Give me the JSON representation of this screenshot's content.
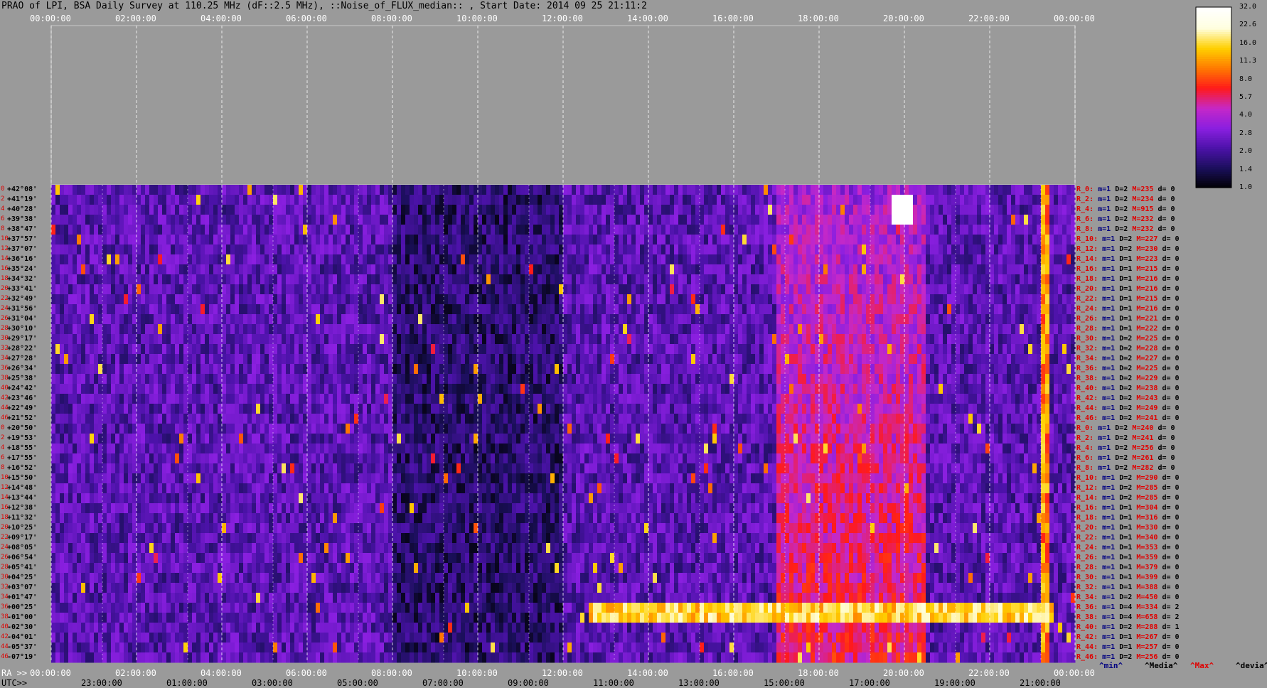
{
  "chart_data": {
    "type": "heatmap",
    "title": "PRAO of LPI, BSA Daily Survey at 110.25 MHz (dF::2.5 MHz), ::Noise_of_FLUX_median:: , Start Date: 2014 09 25 21:11:2",
    "x_top_ticks": [
      "00:00:00",
      "02:00:00",
      "04:00:00",
      "06:00:00",
      "08:00:00",
      "10:00:00",
      "12:00:00",
      "14:00:00",
      "16:00:00",
      "18:00:00",
      "20:00:00",
      "22:00:00",
      "00:00:00"
    ],
    "ra_label": "RA >>",
    "ra_ticks": [
      "00:00:00",
      "02:00:00",
      "04:00:00",
      "06:00:00",
      "08:00:00",
      "10:00:00",
      "12:00:00",
      "14:00:00",
      "16:00:00",
      "18:00:00",
      "20:00:00",
      "22:00:00",
      "00:00:00"
    ],
    "utc_label": "UTC>>",
    "utc_ticks": [
      "23:00:00",
      "01:00:00",
      "03:00:00",
      "05:00:00",
      "07:00:00",
      "09:00:00",
      "11:00:00",
      "13:00:00",
      "15:00:00",
      "17:00:00",
      "19:00:00",
      "21:00:00"
    ],
    "beam_index": [
      "0",
      "2",
      "4",
      "6",
      "8",
      "10",
      "12",
      "14",
      "16",
      "18",
      "20",
      "22",
      "24",
      "26",
      "28",
      "30",
      "32",
      "34",
      "36",
      "38",
      "40",
      "42",
      "44",
      "46",
      "0",
      "2",
      "4",
      "6",
      "8",
      "10",
      "12",
      "14",
      "16",
      "18",
      "20",
      "22",
      "24",
      "26",
      "28",
      "30",
      "32",
      "34",
      "36",
      "38",
      "40",
      "42",
      "44",
      "46"
    ],
    "declinations": [
      "+42°08'",
      "+41°19'",
      "+40°28'",
      "+39°38'",
      "+38°47'",
      "+37°57'",
      "+37°07'",
      "+36°16'",
      "+35°24'",
      "+34°32'",
      "+33°41'",
      "+32°49'",
      "+31°56'",
      "+31°04'",
      "+30°10'",
      "+29°17'",
      "+28°22'",
      "+27°28'",
      "+26°34'",
      "+25°38'",
      "+24°42'",
      "+23°46'",
      "+22°49'",
      "+21°52'",
      "+20°50'",
      "+19°53'",
      "+18°55'",
      "+17°55'",
      "+16°52'",
      "+15°50'",
      "+14°48'",
      "+13°44'",
      "+12°38'",
      "+11°32'",
      "+10°25'",
      "+09°17'",
      "+08°05'",
      "+06°54'",
      "+05°41'",
      "+04°25'",
      "+03°07'",
      "+01°47'",
      "+00°25'",
      "-01°00'",
      "-02°30'",
      "-04°01'",
      "-05°37'",
      "-07°19'"
    ],
    "row_stats": [
      {
        "r": "R_0:",
        "m": "m=1",
        "d": "D=2",
        "M": "M=235",
        "dv": "d= 0"
      },
      {
        "r": "R_2:",
        "m": "m=1",
        "d": "D=2",
        "M": "M=234",
        "dv": "d= 0"
      },
      {
        "r": "R_4:",
        "m": "m=1",
        "d": "D=2",
        "M": "M=915",
        "dv": "d= 0"
      },
      {
        "r": "R_6:",
        "m": "m=1",
        "d": "D=2",
        "M": "M=232",
        "dv": "d= 0"
      },
      {
        "r": "R_8:",
        "m": "m=1",
        "d": "D=2",
        "M": "M=232",
        "dv": "d= 0"
      },
      {
        "r": "R_10:",
        "m": "m=1",
        "d": "D=2",
        "M": "M=227",
        "dv": "d= 0"
      },
      {
        "r": "R_12:",
        "m": "m=1",
        "d": "D=2",
        "M": "M=230",
        "dv": "d= 0"
      },
      {
        "r": "R_14:",
        "m": "m=1",
        "d": "D=1",
        "M": "M=223",
        "dv": "d= 0"
      },
      {
        "r": "R_16:",
        "m": "m=1",
        "d": "D=1",
        "M": "M=215",
        "dv": "d= 0"
      },
      {
        "r": "R_18:",
        "m": "m=1",
        "d": "D=1",
        "M": "M=216",
        "dv": "d= 0"
      },
      {
        "r": "R_20:",
        "m": "m=1",
        "d": "D=1",
        "M": "M=216",
        "dv": "d= 0"
      },
      {
        "r": "R_22:",
        "m": "m=1",
        "d": "D=1",
        "M": "M=215",
        "dv": "d= 0"
      },
      {
        "r": "R_24:",
        "m": "m=1",
        "d": "D=1",
        "M": "M=216",
        "dv": "d= 0"
      },
      {
        "r": "R_26:",
        "m": "m=1",
        "d": "D=1",
        "M": "M=221",
        "dv": "d= 0"
      },
      {
        "r": "R_28:",
        "m": "m=1",
        "d": "D=1",
        "M": "M=222",
        "dv": "d= 0"
      },
      {
        "r": "R_30:",
        "m": "m=1",
        "d": "D=2",
        "M": "M=225",
        "dv": "d= 0"
      },
      {
        "r": "R_32:",
        "m": "m=1",
        "d": "D=2",
        "M": "M=228",
        "dv": "d= 0"
      },
      {
        "r": "R_34:",
        "m": "m=1",
        "d": "D=2",
        "M": "M=227",
        "dv": "d= 0"
      },
      {
        "r": "R_36:",
        "m": "m=1",
        "d": "D=2",
        "M": "M=225",
        "dv": "d= 0"
      },
      {
        "r": "R_38:",
        "m": "m=1",
        "d": "D=2",
        "M": "M=229",
        "dv": "d= 0"
      },
      {
        "r": "R_40:",
        "m": "m=1",
        "d": "D=2",
        "M": "M=238",
        "dv": "d= 0"
      },
      {
        "r": "R_42:",
        "m": "m=1",
        "d": "D=2",
        "M": "M=243",
        "dv": "d= 0"
      },
      {
        "r": "R_44:",
        "m": "m=1",
        "d": "D=2",
        "M": "M=249",
        "dv": "d= 0"
      },
      {
        "r": "R_46:",
        "m": "m=1",
        "d": "D=2",
        "M": "M=241",
        "dv": "d= 0"
      },
      {
        "r": "R_0:",
        "m": "m=1",
        "d": "D=2",
        "M": "M=240",
        "dv": "d= 0"
      },
      {
        "r": "R_2:",
        "m": "m=1",
        "d": "D=2",
        "M": "M=241",
        "dv": "d= 0"
      },
      {
        "r": "R_4:",
        "m": "m=1",
        "d": "D=2",
        "M": "M=256",
        "dv": "d= 0"
      },
      {
        "r": "R_6:",
        "m": "m=1",
        "d": "D=2",
        "M": "M=261",
        "dv": "d= 0"
      },
      {
        "r": "R_8:",
        "m": "m=1",
        "d": "D=2",
        "M": "M=282",
        "dv": "d= 0"
      },
      {
        "r": "R_10:",
        "m": "m=1",
        "d": "D=2",
        "M": "M=290",
        "dv": "d= 0"
      },
      {
        "r": "R_12:",
        "m": "m=1",
        "d": "D=2",
        "M": "M=285",
        "dv": "d= 0"
      },
      {
        "r": "R_14:",
        "m": "m=1",
        "d": "D=2",
        "M": "M=285",
        "dv": "d= 0"
      },
      {
        "r": "R_16:",
        "m": "m=1",
        "d": "D=1",
        "M": "M=304",
        "dv": "d= 0"
      },
      {
        "r": "R_18:",
        "m": "m=1",
        "d": "D=1",
        "M": "M=316",
        "dv": "d= 0"
      },
      {
        "r": "R_20:",
        "m": "m=1",
        "d": "D=1",
        "M": "M=330",
        "dv": "d= 0"
      },
      {
        "r": "R_22:",
        "m": "m=1",
        "d": "D=1",
        "M": "M=340",
        "dv": "d= 0"
      },
      {
        "r": "R_24:",
        "m": "m=1",
        "d": "D=1",
        "M": "M=353",
        "dv": "d= 0"
      },
      {
        "r": "R_26:",
        "m": "m=1",
        "d": "D=1",
        "M": "M=359",
        "dv": "d= 0"
      },
      {
        "r": "R_28:",
        "m": "m=1",
        "d": "D=1",
        "M": "M=379",
        "dv": "d= 0"
      },
      {
        "r": "R_30:",
        "m": "m=1",
        "d": "D=1",
        "M": "M=399",
        "dv": "d= 0"
      },
      {
        "r": "R_32:",
        "m": "m=1",
        "d": "D=1",
        "M": "M=388",
        "dv": "d= 0"
      },
      {
        "r": "R_34:",
        "m": "m=1",
        "d": "D=2",
        "M": "M=450",
        "dv": "d= 0"
      },
      {
        "r": "R_36:",
        "m": "m=1",
        "d": "D=4",
        "M": "M=334",
        "dv": "d= 2"
      },
      {
        "r": "R_38:",
        "m": "m=1",
        "d": "D=4",
        "M": "M=658",
        "dv": "d= 2"
      },
      {
        "r": "R_40:",
        "m": "m=1",
        "d": "D=2",
        "M": "M=288",
        "dv": "d= 1"
      },
      {
        "r": "R_42:",
        "m": "m=1",
        "d": "D=1",
        "M": "M=267",
        "dv": "d= 0"
      },
      {
        "r": "R_44:",
        "m": "m=1",
        "d": "D=1",
        "M": "M=257",
        "dv": "d= 0"
      },
      {
        "r": "R_46:",
        "m": "m=1",
        "d": "D=2",
        "M": "M=256",
        "dv": "d= 0"
      }
    ],
    "stat_legend": [
      "^min^",
      "^Media^",
      "^Max^",
      "^devia^"
    ],
    "colorbar_ticks": [
      "32.0",
      "22.6",
      "16.0",
      "11.3",
      "8.0",
      "5.7",
      "4.0",
      "2.8",
      "2.0",
      "1.4",
      "1.0"
    ],
    "colorbar_range": [
      1.0,
      32.0
    ],
    "colorbar_scale": "log",
    "colormap": [
      "#000000",
      "#1a0f5a",
      "#4b12a8",
      "#8a1fe0",
      "#c528c8",
      "#ff1a1a",
      "#ff7a00",
      "#ffd000",
      "#ffffe0",
      "#ffffff"
    ],
    "features": [
      {
        "note": "bright horizontal band R_36-R_38 from ~12:30 to ~23:30 RA",
        "row_start": 42,
        "row_end": 43,
        "x_start": 12.6,
        "x_end": 23.5,
        "level": 18
      },
      {
        "note": "strong vertical source near RA 23:30",
        "x": 23.3,
        "level": 14
      },
      {
        "note": "bright point source near RA 20:00, R_4",
        "x": 19.96,
        "row": 2,
        "level": 32
      },
      {
        "note": "Galactic plane crossing 18:30-20:00",
        "x_start": 18.5,
        "x_end": 20.2,
        "level": 6
      }
    ]
  }
}
